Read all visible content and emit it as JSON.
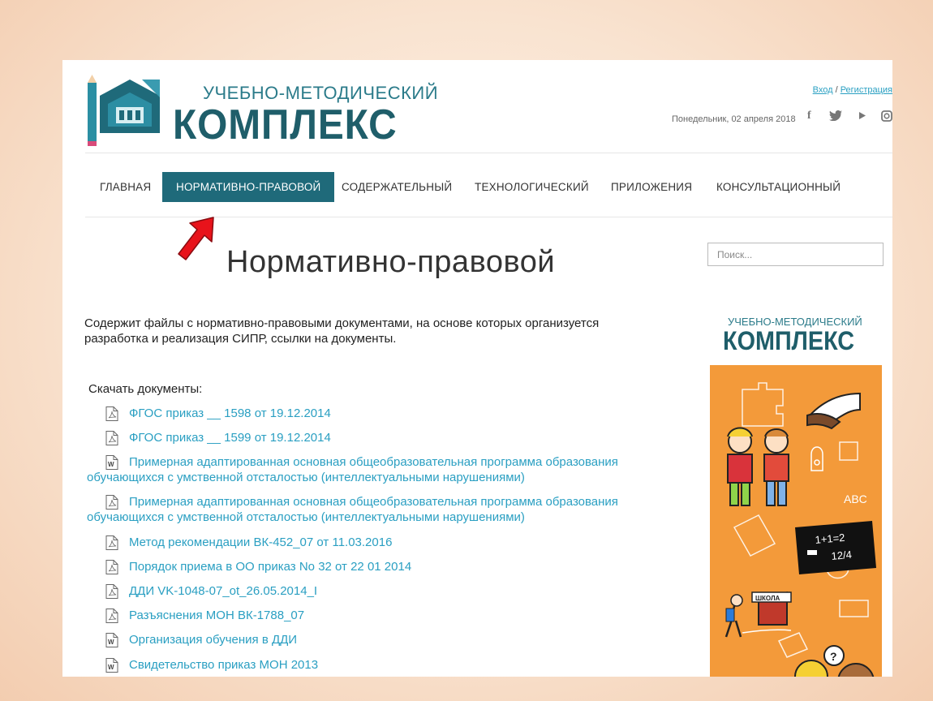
{
  "header": {
    "logo_top": "УЧЕБНО-МЕТОДИЧЕСКИЙ",
    "logo_main": "КОМПЛЕКС",
    "login": "Вход",
    "separator": " / ",
    "register": "Регистрация",
    "date": "Понедельник, 02 апреля 2018",
    "social": [
      "facebook-icon",
      "twitter-icon",
      "youtube-icon",
      "instagram-icon"
    ]
  },
  "nav": {
    "items": [
      {
        "label": "ГЛАВНАЯ"
      },
      {
        "label": "НОРМАТИВНО-ПРАВОВОЙ",
        "active": true
      },
      {
        "label": "СОДЕРЖАТЕЛЬНЫЙ"
      },
      {
        "label": "ТЕХНОЛОГИЧЕСКИЙ"
      },
      {
        "label": "ПРИЛОЖЕНИЯ"
      },
      {
        "label": "КОНСУЛЬТАЦИОННЫЙ"
      }
    ]
  },
  "main": {
    "title": "Нормативно-правовой",
    "description": "Содержит файлы с нормативно-правовыми документами, на основе которых организуется разработка и реализация СИПР, ссылки на документы.",
    "downloads_title": "Скачать документы:",
    "documents": [
      {
        "type": "pdf",
        "label": "ФГОС приказ __ 1598 от 19.12.2014"
      },
      {
        "type": "pdf",
        "label": "ФГОС приказ __ 1599 от 19.12.2014"
      },
      {
        "type": "doc",
        "label": "Примерная адаптированная основная общеобразовательная программа образования обучающихся с умственной отсталостью (интеллектуальными нарушениями)"
      },
      {
        "type": "pdf",
        "label": "Примерная адаптированная основная общеобразовательная программа образования обучающихся с умственной отсталостью (интеллектуальными нарушениями)"
      },
      {
        "type": "pdf",
        "label": "Метод рекомендации ВК-452_07 от 11.03.2016"
      },
      {
        "type": "pdf",
        "label": "Порядок приема в ОО приказ No 32 от 22 01 2014"
      },
      {
        "type": "pdf",
        "label": "ДДИ VK-1048-07_ot_26.05.2014_I"
      },
      {
        "type": "pdf",
        "label": "Разъяснения МОН ВК-1788_07"
      },
      {
        "type": "doc",
        "label": "Организация обучения в ДДИ"
      },
      {
        "type": "doc",
        "label": "Свидетельство приказ МОН 2013"
      }
    ]
  },
  "sidebar": {
    "search_placeholder": "Поиск...",
    "logo_top": "УЧЕБНО-МЕТОДИЧЕСКИЙ",
    "logo_main": "КОМПЛЕКС",
    "banner_math": "1+1=2",
    "banner_frac": "12/4",
    "banner_abc": "ABC",
    "banner_school": "ШКОЛА"
  },
  "colors": {
    "accent": "#1f6a7a",
    "link": "#2a9fc2",
    "banner": "#f39a3a"
  }
}
